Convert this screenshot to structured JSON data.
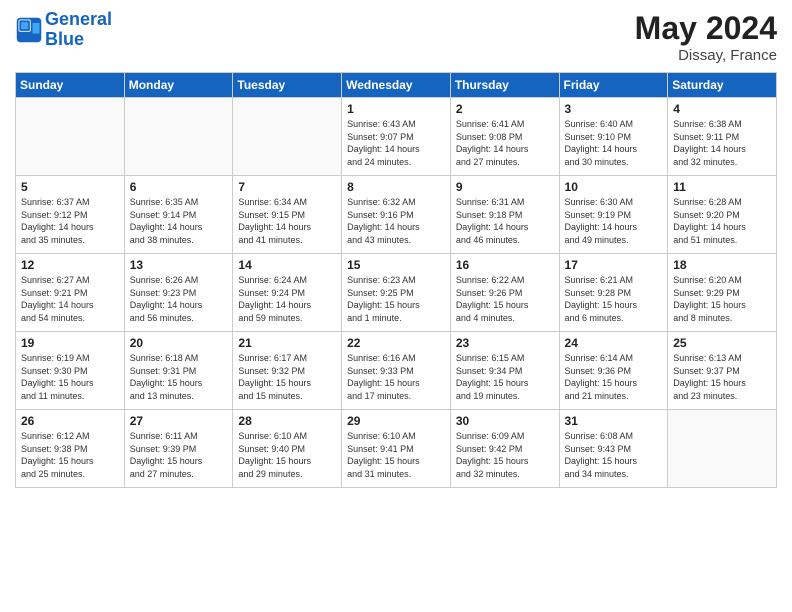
{
  "header": {
    "logo_line1": "General",
    "logo_line2": "Blue",
    "title": "May 2024",
    "subtitle": "Dissay, France"
  },
  "days_of_week": [
    "Sunday",
    "Monday",
    "Tuesday",
    "Wednesday",
    "Thursday",
    "Friday",
    "Saturday"
  ],
  "weeks": [
    [
      {
        "day": "",
        "info": ""
      },
      {
        "day": "",
        "info": ""
      },
      {
        "day": "",
        "info": ""
      },
      {
        "day": "1",
        "info": "Sunrise: 6:43 AM\nSunset: 9:07 PM\nDaylight: 14 hours\nand 24 minutes."
      },
      {
        "day": "2",
        "info": "Sunrise: 6:41 AM\nSunset: 9:08 PM\nDaylight: 14 hours\nand 27 minutes."
      },
      {
        "day": "3",
        "info": "Sunrise: 6:40 AM\nSunset: 9:10 PM\nDaylight: 14 hours\nand 30 minutes."
      },
      {
        "day": "4",
        "info": "Sunrise: 6:38 AM\nSunset: 9:11 PM\nDaylight: 14 hours\nand 32 minutes."
      }
    ],
    [
      {
        "day": "5",
        "info": "Sunrise: 6:37 AM\nSunset: 9:12 PM\nDaylight: 14 hours\nand 35 minutes."
      },
      {
        "day": "6",
        "info": "Sunrise: 6:35 AM\nSunset: 9:14 PM\nDaylight: 14 hours\nand 38 minutes."
      },
      {
        "day": "7",
        "info": "Sunrise: 6:34 AM\nSunset: 9:15 PM\nDaylight: 14 hours\nand 41 minutes."
      },
      {
        "day": "8",
        "info": "Sunrise: 6:32 AM\nSunset: 9:16 PM\nDaylight: 14 hours\nand 43 minutes."
      },
      {
        "day": "9",
        "info": "Sunrise: 6:31 AM\nSunset: 9:18 PM\nDaylight: 14 hours\nand 46 minutes."
      },
      {
        "day": "10",
        "info": "Sunrise: 6:30 AM\nSunset: 9:19 PM\nDaylight: 14 hours\nand 49 minutes."
      },
      {
        "day": "11",
        "info": "Sunrise: 6:28 AM\nSunset: 9:20 PM\nDaylight: 14 hours\nand 51 minutes."
      }
    ],
    [
      {
        "day": "12",
        "info": "Sunrise: 6:27 AM\nSunset: 9:21 PM\nDaylight: 14 hours\nand 54 minutes."
      },
      {
        "day": "13",
        "info": "Sunrise: 6:26 AM\nSunset: 9:23 PM\nDaylight: 14 hours\nand 56 minutes."
      },
      {
        "day": "14",
        "info": "Sunrise: 6:24 AM\nSunset: 9:24 PM\nDaylight: 14 hours\nand 59 minutes."
      },
      {
        "day": "15",
        "info": "Sunrise: 6:23 AM\nSunset: 9:25 PM\nDaylight: 15 hours\nand 1 minute."
      },
      {
        "day": "16",
        "info": "Sunrise: 6:22 AM\nSunset: 9:26 PM\nDaylight: 15 hours\nand 4 minutes."
      },
      {
        "day": "17",
        "info": "Sunrise: 6:21 AM\nSunset: 9:28 PM\nDaylight: 15 hours\nand 6 minutes."
      },
      {
        "day": "18",
        "info": "Sunrise: 6:20 AM\nSunset: 9:29 PM\nDaylight: 15 hours\nand 8 minutes."
      }
    ],
    [
      {
        "day": "19",
        "info": "Sunrise: 6:19 AM\nSunset: 9:30 PM\nDaylight: 15 hours\nand 11 minutes."
      },
      {
        "day": "20",
        "info": "Sunrise: 6:18 AM\nSunset: 9:31 PM\nDaylight: 15 hours\nand 13 minutes."
      },
      {
        "day": "21",
        "info": "Sunrise: 6:17 AM\nSunset: 9:32 PM\nDaylight: 15 hours\nand 15 minutes."
      },
      {
        "day": "22",
        "info": "Sunrise: 6:16 AM\nSunset: 9:33 PM\nDaylight: 15 hours\nand 17 minutes."
      },
      {
        "day": "23",
        "info": "Sunrise: 6:15 AM\nSunset: 9:34 PM\nDaylight: 15 hours\nand 19 minutes."
      },
      {
        "day": "24",
        "info": "Sunrise: 6:14 AM\nSunset: 9:36 PM\nDaylight: 15 hours\nand 21 minutes."
      },
      {
        "day": "25",
        "info": "Sunrise: 6:13 AM\nSunset: 9:37 PM\nDaylight: 15 hours\nand 23 minutes."
      }
    ],
    [
      {
        "day": "26",
        "info": "Sunrise: 6:12 AM\nSunset: 9:38 PM\nDaylight: 15 hours\nand 25 minutes."
      },
      {
        "day": "27",
        "info": "Sunrise: 6:11 AM\nSunset: 9:39 PM\nDaylight: 15 hours\nand 27 minutes."
      },
      {
        "day": "28",
        "info": "Sunrise: 6:10 AM\nSunset: 9:40 PM\nDaylight: 15 hours\nand 29 minutes."
      },
      {
        "day": "29",
        "info": "Sunrise: 6:10 AM\nSunset: 9:41 PM\nDaylight: 15 hours\nand 31 minutes."
      },
      {
        "day": "30",
        "info": "Sunrise: 6:09 AM\nSunset: 9:42 PM\nDaylight: 15 hours\nand 32 minutes."
      },
      {
        "day": "31",
        "info": "Sunrise: 6:08 AM\nSunset: 9:43 PM\nDaylight: 15 hours\nand 34 minutes."
      },
      {
        "day": "",
        "info": ""
      }
    ]
  ]
}
